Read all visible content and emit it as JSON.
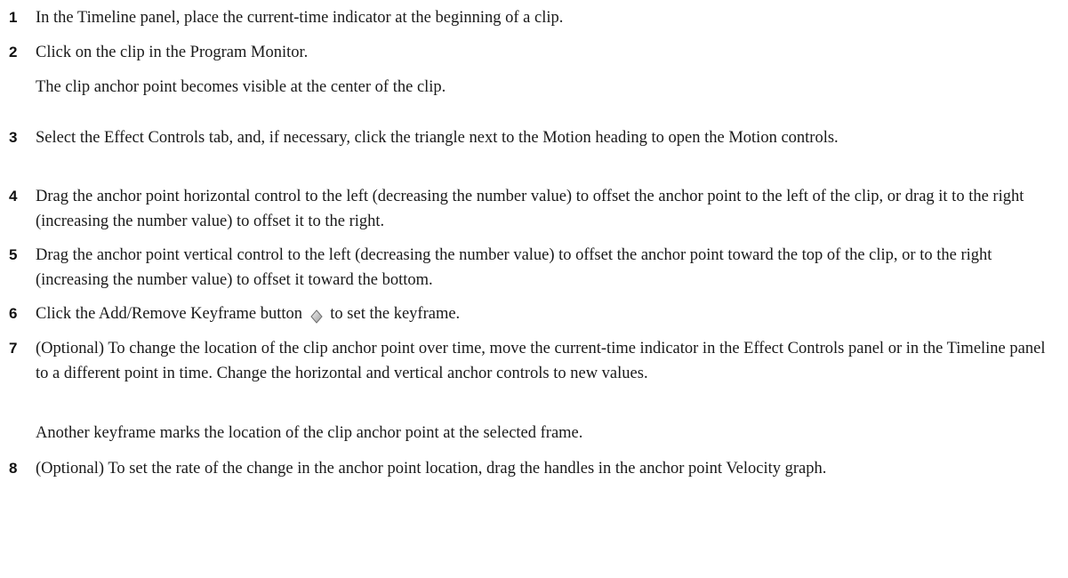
{
  "steps": [
    {
      "num": "1",
      "text": "In the Timeline panel, place the current-time indicator at the beginning of a clip."
    },
    {
      "num": "2",
      "text": "Click on the clip in the Program Monitor.",
      "note": "The clip anchor point becomes visible at the center of the clip."
    },
    {
      "num": "3",
      "text": "Select the Effect Controls tab, and, if necessary, click the triangle next to the Motion heading to open the Motion controls."
    },
    {
      "num": "4",
      "text": "Drag the anchor point horizontal control to the left (decreasing the number value) to offset the anchor point to the left of the clip, or drag it to the right (increasing the number value) to offset it to the right."
    },
    {
      "num": "5",
      "text": "Drag the anchor point vertical control to the left (decreasing the number value) to offset the anchor point toward the top of the clip, or to the right (increasing the number value) to offset it toward the bottom."
    },
    {
      "num": "6",
      "text_before": "Click the Add/Remove Keyframe button",
      "text_after": "to set the keyframe.",
      "icon": "keyframe-diamond-icon"
    },
    {
      "num": "7",
      "text": "(Optional) To change the location of the clip anchor point over time, move the current-time indicator in the Effect Controls panel or in the Timeline panel to a different point in time. Change the horizontal and vertical anchor controls to new values.",
      "note": "Another keyframe marks the location of the clip anchor point at the selected frame."
    },
    {
      "num": "8",
      "text": "(Optional) To set the rate of the change in the anchor point location, drag the handles in the anchor point Velocity graph."
    }
  ]
}
